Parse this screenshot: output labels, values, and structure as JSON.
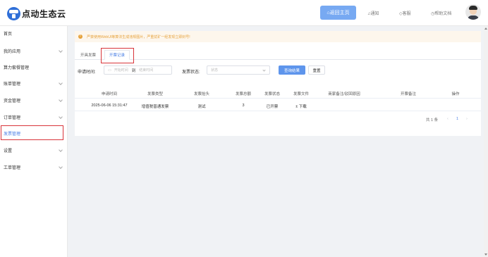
{
  "header": {
    "logo_text": "点动生态云",
    "home_button": "⌂返回主页",
    "notify": "♫通知",
    "feedback": "◇客服",
    "help": "◷帮助文档"
  },
  "sidebar": {
    "items": [
      {
        "label": "首页",
        "expandable": false
      },
      {
        "label": "我的应用",
        "expandable": true
      },
      {
        "label": "算力套餐管理",
        "expandable": false
      },
      {
        "label": "账单管理",
        "expandable": true
      },
      {
        "label": "资金管理",
        "expandable": true
      },
      {
        "label": "订单管理",
        "expandable": true
      },
      {
        "label": "发票管理",
        "expandable": false,
        "active": true
      },
      {
        "label": "设置",
        "expandable": true
      },
      {
        "label": "工单管理",
        "expandable": true
      }
    ]
  },
  "notice": {
    "text": "严禁使用WebUI等算法生成违规图片，严重扰矿一经发现立即封号!"
  },
  "tabs": [
    {
      "label": "开具发票",
      "active": false
    },
    {
      "label": "开票记录",
      "active": true
    }
  ],
  "filters": {
    "apply_time_label": "申请时间:",
    "start_placeholder": "开始时间",
    "range_sep": "到",
    "end_placeholder": "结束时间",
    "status_label": "发票状态:",
    "status_placeholder": "状态",
    "query_button": "查询结果",
    "reset_button": "重置"
  },
  "table": {
    "columns": [
      "申请时间",
      "发票类型",
      "发票抬头",
      "发票总额",
      "发票状态",
      "发票文件",
      "商家备注/驳回原因",
      "开票备注",
      "操作"
    ],
    "rows": [
      [
        "2025-06-06 15:31:47",
        "增值税普通发票",
        "测试",
        "3",
        "已开票",
        "± 下载",
        "",
        "",
        ""
      ]
    ]
  },
  "pagination": {
    "total": "共 1 条",
    "prev": "‹",
    "page": "1",
    "next": "›"
  }
}
